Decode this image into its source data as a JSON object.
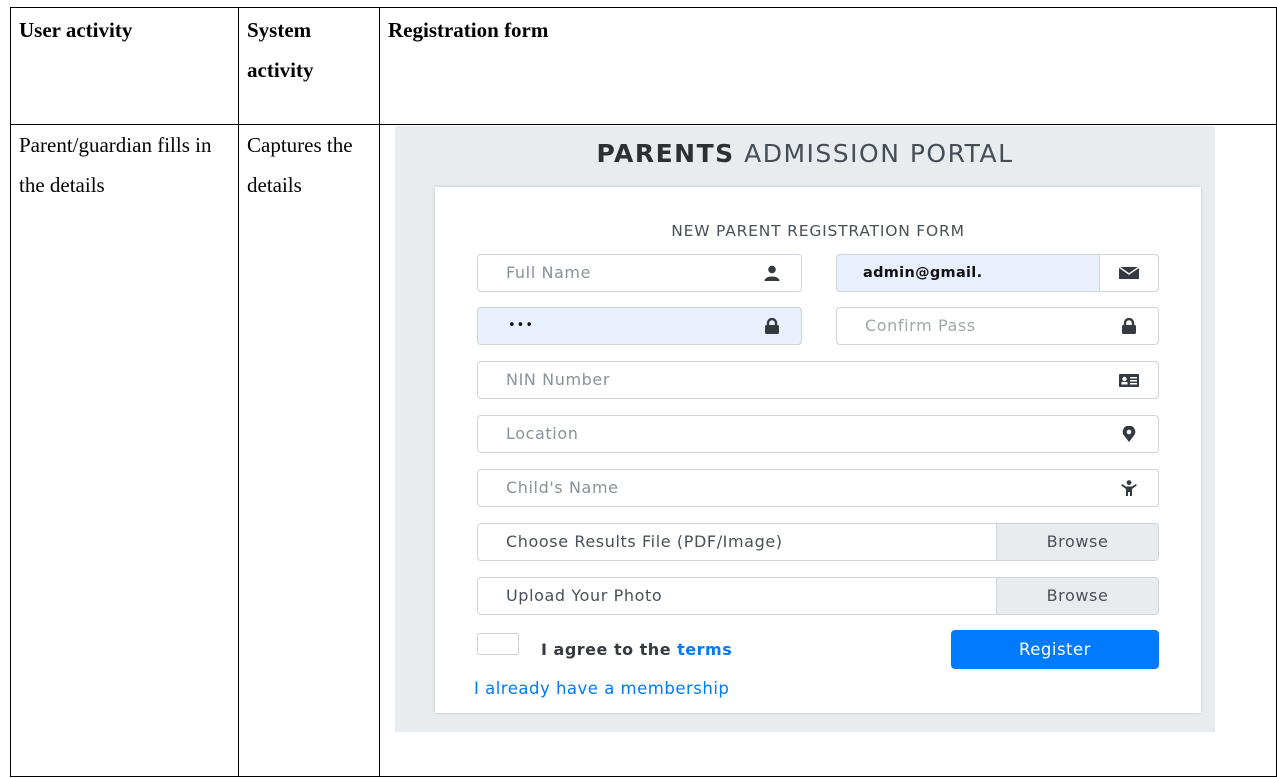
{
  "table": {
    "headers": [
      "User activity",
      "System activity",
      "Registration form"
    ],
    "row": {
      "user_activity": "Parent/guardian fills in the details",
      "system_activity": "Captures the details"
    }
  },
  "portal": {
    "title_bold": "PARENTS",
    "title_rest": "ADMISSION PORTAL",
    "form_title": "NEW PARENT REGISTRATION FORM",
    "full_name_placeholder": "Full Name",
    "email_value": "admin@gmail.",
    "password_value": "•••",
    "confirm_placeholder": "Confirm Pass",
    "nin_placeholder": "NIN Number",
    "location_placeholder": "Location",
    "child_placeholder": "Child's Name",
    "results_file_label": "Choose Results File (PDF/Image)",
    "photo_label": "Upload Your Photo",
    "browse_label": "Browse",
    "agree_text": "I agree to the",
    "terms_link": "terms",
    "register_label": "Register",
    "membership_link": "I already have a membership",
    "icons": [
      "user-icon",
      "envelope-icon",
      "lock-icon",
      "lock-icon",
      "id-card-icon",
      "map-marker-icon",
      "child-icon"
    ],
    "colors": {
      "primary": "#007bff",
      "autofill": "#e8f0fe",
      "panel": "#e9ecef"
    }
  }
}
